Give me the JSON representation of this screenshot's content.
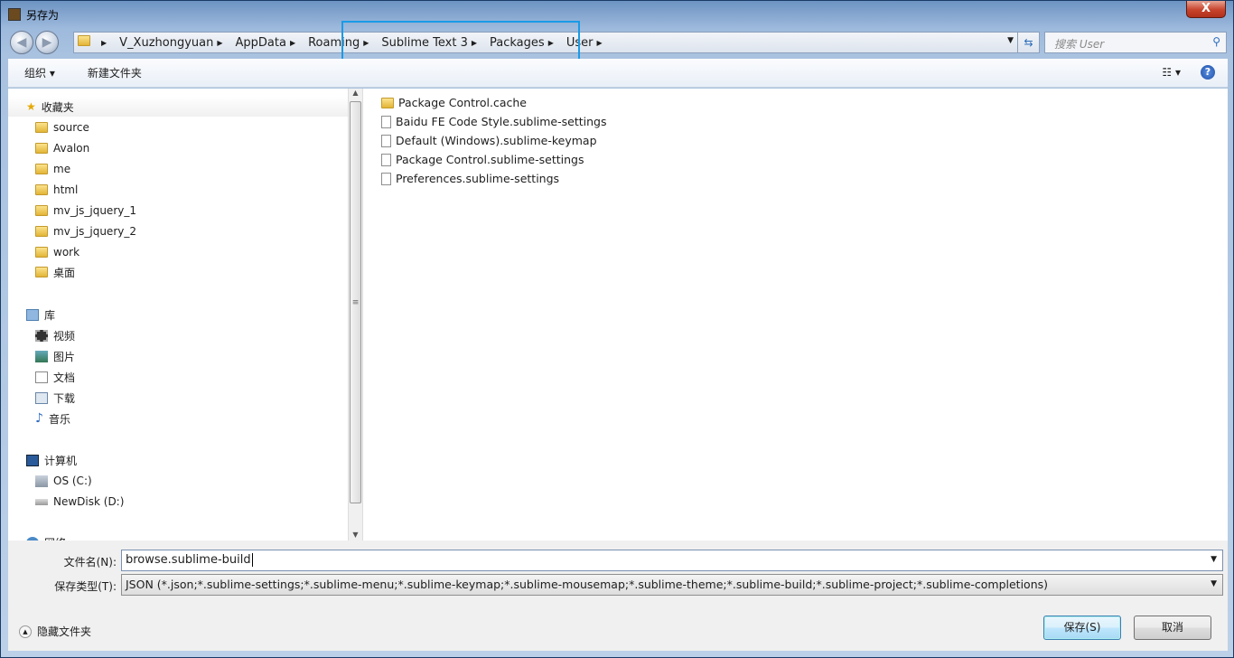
{
  "window": {
    "title": "另存为",
    "close_label": "X"
  },
  "nav": {
    "back": "◀",
    "forward": "▶"
  },
  "breadcrumb": [
    "V_Xuzhongyuan",
    "AppData",
    "Roaming",
    "Sublime Text 3",
    "Packages",
    "User"
  ],
  "search": {
    "placeholder": "搜索 User"
  },
  "toolbar": {
    "organize": "组织 ▾",
    "new_folder": "新建文件夹",
    "view": "☷ ▾",
    "help": "?"
  },
  "sidebar": {
    "favorites": {
      "label": "收藏夹",
      "items": [
        "source",
        "Avalon",
        "me",
        "html",
        "mv_js_jquery_1",
        "mv_js_jquery_2",
        "work",
        "桌面"
      ]
    },
    "libraries": {
      "label": "库",
      "items": [
        "视频",
        "图片",
        "文档",
        "下载",
        "音乐"
      ]
    },
    "computer": {
      "label": "计算机",
      "items": [
        "OS (C:)",
        "NewDisk (D:)"
      ]
    },
    "network": {
      "label": "网络"
    }
  },
  "files": [
    {
      "name": "Package Control.cache",
      "type": "folder"
    },
    {
      "name": "Baidu FE Code Style.sublime-settings",
      "type": "file"
    },
    {
      "name": "Default (Windows).sublime-keymap",
      "type": "file"
    },
    {
      "name": "Package Control.sublime-settings",
      "type": "file"
    },
    {
      "name": "Preferences.sublime-settings",
      "type": "file"
    }
  ],
  "form": {
    "filename_label": "文件名(N):",
    "filename_value": "browse.sublime-build",
    "filetype_label": "保存类型(T):",
    "filetype_value": "JSON (*.json;*.sublime-settings;*.sublime-menu;*.sublime-keymap;*.sublime-mousemap;*.sublime-theme;*.sublime-build;*.sublime-project;*.sublime-completions)"
  },
  "footer": {
    "hide_folders": "隐藏文件夹",
    "save": "保存(S)",
    "cancel": "取消"
  }
}
